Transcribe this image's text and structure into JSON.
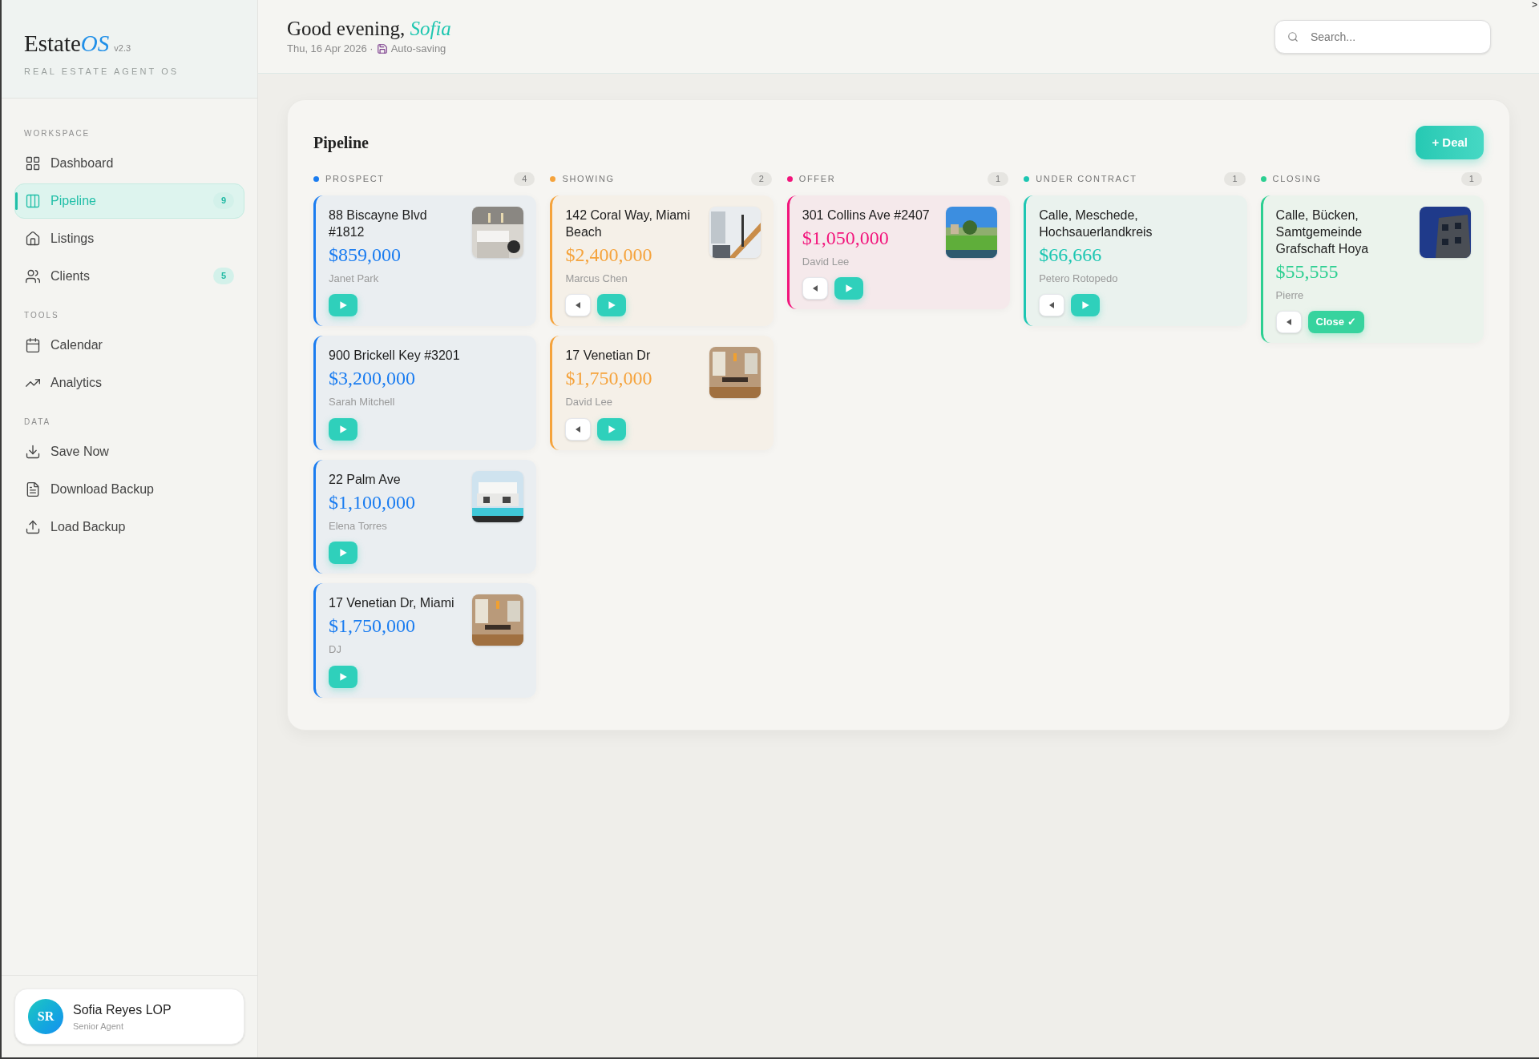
{
  "edge_mark": ">",
  "brand": {
    "name": "Estate",
    "accent": "OS",
    "version": "v2.3",
    "tagline": "REAL ESTATE AGENT OS"
  },
  "sidebar": {
    "sections": [
      {
        "title": "WORKSPACE",
        "items": [
          {
            "label": "Dashboard",
            "selected": false
          },
          {
            "label": "Pipeline",
            "badge": "9",
            "selected": true
          },
          {
            "label": "Listings",
            "selected": false
          },
          {
            "label": "Clients",
            "badge": "5",
            "selected": false
          }
        ]
      },
      {
        "title": "TOOLS",
        "items": [
          {
            "label": "Calendar",
            "selected": false
          },
          {
            "label": "Analytics",
            "selected": false
          }
        ]
      },
      {
        "title": "DATA",
        "items": [
          {
            "label": "Save Now",
            "selected": false
          },
          {
            "label": "Download Backup",
            "selected": false
          },
          {
            "label": "Load Backup",
            "selected": false
          }
        ]
      }
    ]
  },
  "user": {
    "initials": "SR",
    "name": "Sofia Reyes LOP",
    "role": "Senior Agent"
  },
  "header": {
    "greeting": "Good evening,",
    "name": "Sofia",
    "date": "Thu, 16 Apr 2026 ·",
    "status": "Auto-saving"
  },
  "search": {
    "placeholder": "Search..."
  },
  "pipeline": {
    "title": "Pipeline",
    "add_button": "+ Deal",
    "columns": [
      {
        "label": "PROSPECT",
        "count": "4",
        "color": "#1a7cf0",
        "cards": [
          {
            "title": "88 Biscayne Blvd #1812",
            "price": "$859,000",
            "agent": "Janet Park",
            "photo": {
              "kind": "picture"
            },
            "actions": [
              {
                "kind": "forward"
              }
            ]
          },
          {
            "title": "900 Brickell Key #3201",
            "price": "$3,200,000",
            "agent": "Sarah Mitchell",
            "actions": [
              {
                "kind": "forward"
              }
            ]
          },
          {
            "title": "22 Palm Ave",
            "price": "$1,100,000",
            "agent": "Elena Torres",
            "photo": {
              "kind": "picture"
            },
            "actions": [
              {
                "kind": "forward"
              }
            ]
          },
          {
            "title": "17 Venetian Dr, Miami",
            "price": "$1,750,000",
            "agent": "DJ",
            "photo": {
              "kind": "picture"
            },
            "actions": [
              {
                "kind": "forward"
              }
            ]
          }
        ]
      },
      {
        "label": "SHOWING",
        "count": "2",
        "color": "#f5a33c",
        "cards": [
          {
            "title": "142 Coral Way, Miami Beach",
            "price": "$2,400,000",
            "agent": "Marcus Chen",
            "photo": {
              "kind": "picture"
            },
            "actions": [
              {
                "kind": "back"
              },
              {
                "kind": "forward"
              }
            ]
          },
          {
            "title": "17 Venetian Dr",
            "price": "$1,750,000",
            "agent": "David Lee",
            "photo": {
              "kind": "picture"
            },
            "actions": [
              {
                "kind": "back"
              },
              {
                "kind": "forward"
              }
            ]
          }
        ]
      },
      {
        "label": "OFFER",
        "count": "1",
        "color": "#f2157c",
        "cards": [
          {
            "title": "301 Collins Ave #2407",
            "price": "$1,050,000",
            "agent": "David Lee",
            "photo": {
              "kind": "picture"
            },
            "actions": [
              {
                "kind": "back"
              },
              {
                "kind": "forward"
              }
            ]
          }
        ]
      },
      {
        "label": "UNDER CONTRACT",
        "count": "1",
        "color": "#1cc6b2",
        "cards": [
          {
            "title": "Calle, Meschede, Hochsauerlandkreis",
            "price": "$66,666",
            "agent": "Petero Rotopedo",
            "actions": [
              {
                "kind": "back"
              },
              {
                "kind": "forward"
              }
            ]
          }
        ]
      },
      {
        "label": "CLOSING",
        "count": "1",
        "color": "#2ccf91",
        "cards": [
          {
            "title": "Calle, Bücken, Samtgemeinde Grafschaft Hoya",
            "price": "$55,555",
            "agent": "Pierre",
            "photo": {
              "kind": "picture"
            },
            "actions": [
              {
                "kind": "back"
              },
              {
                "kind": "close",
                "label": "Close ✓"
              }
            ]
          }
        ]
      }
    ]
  }
}
